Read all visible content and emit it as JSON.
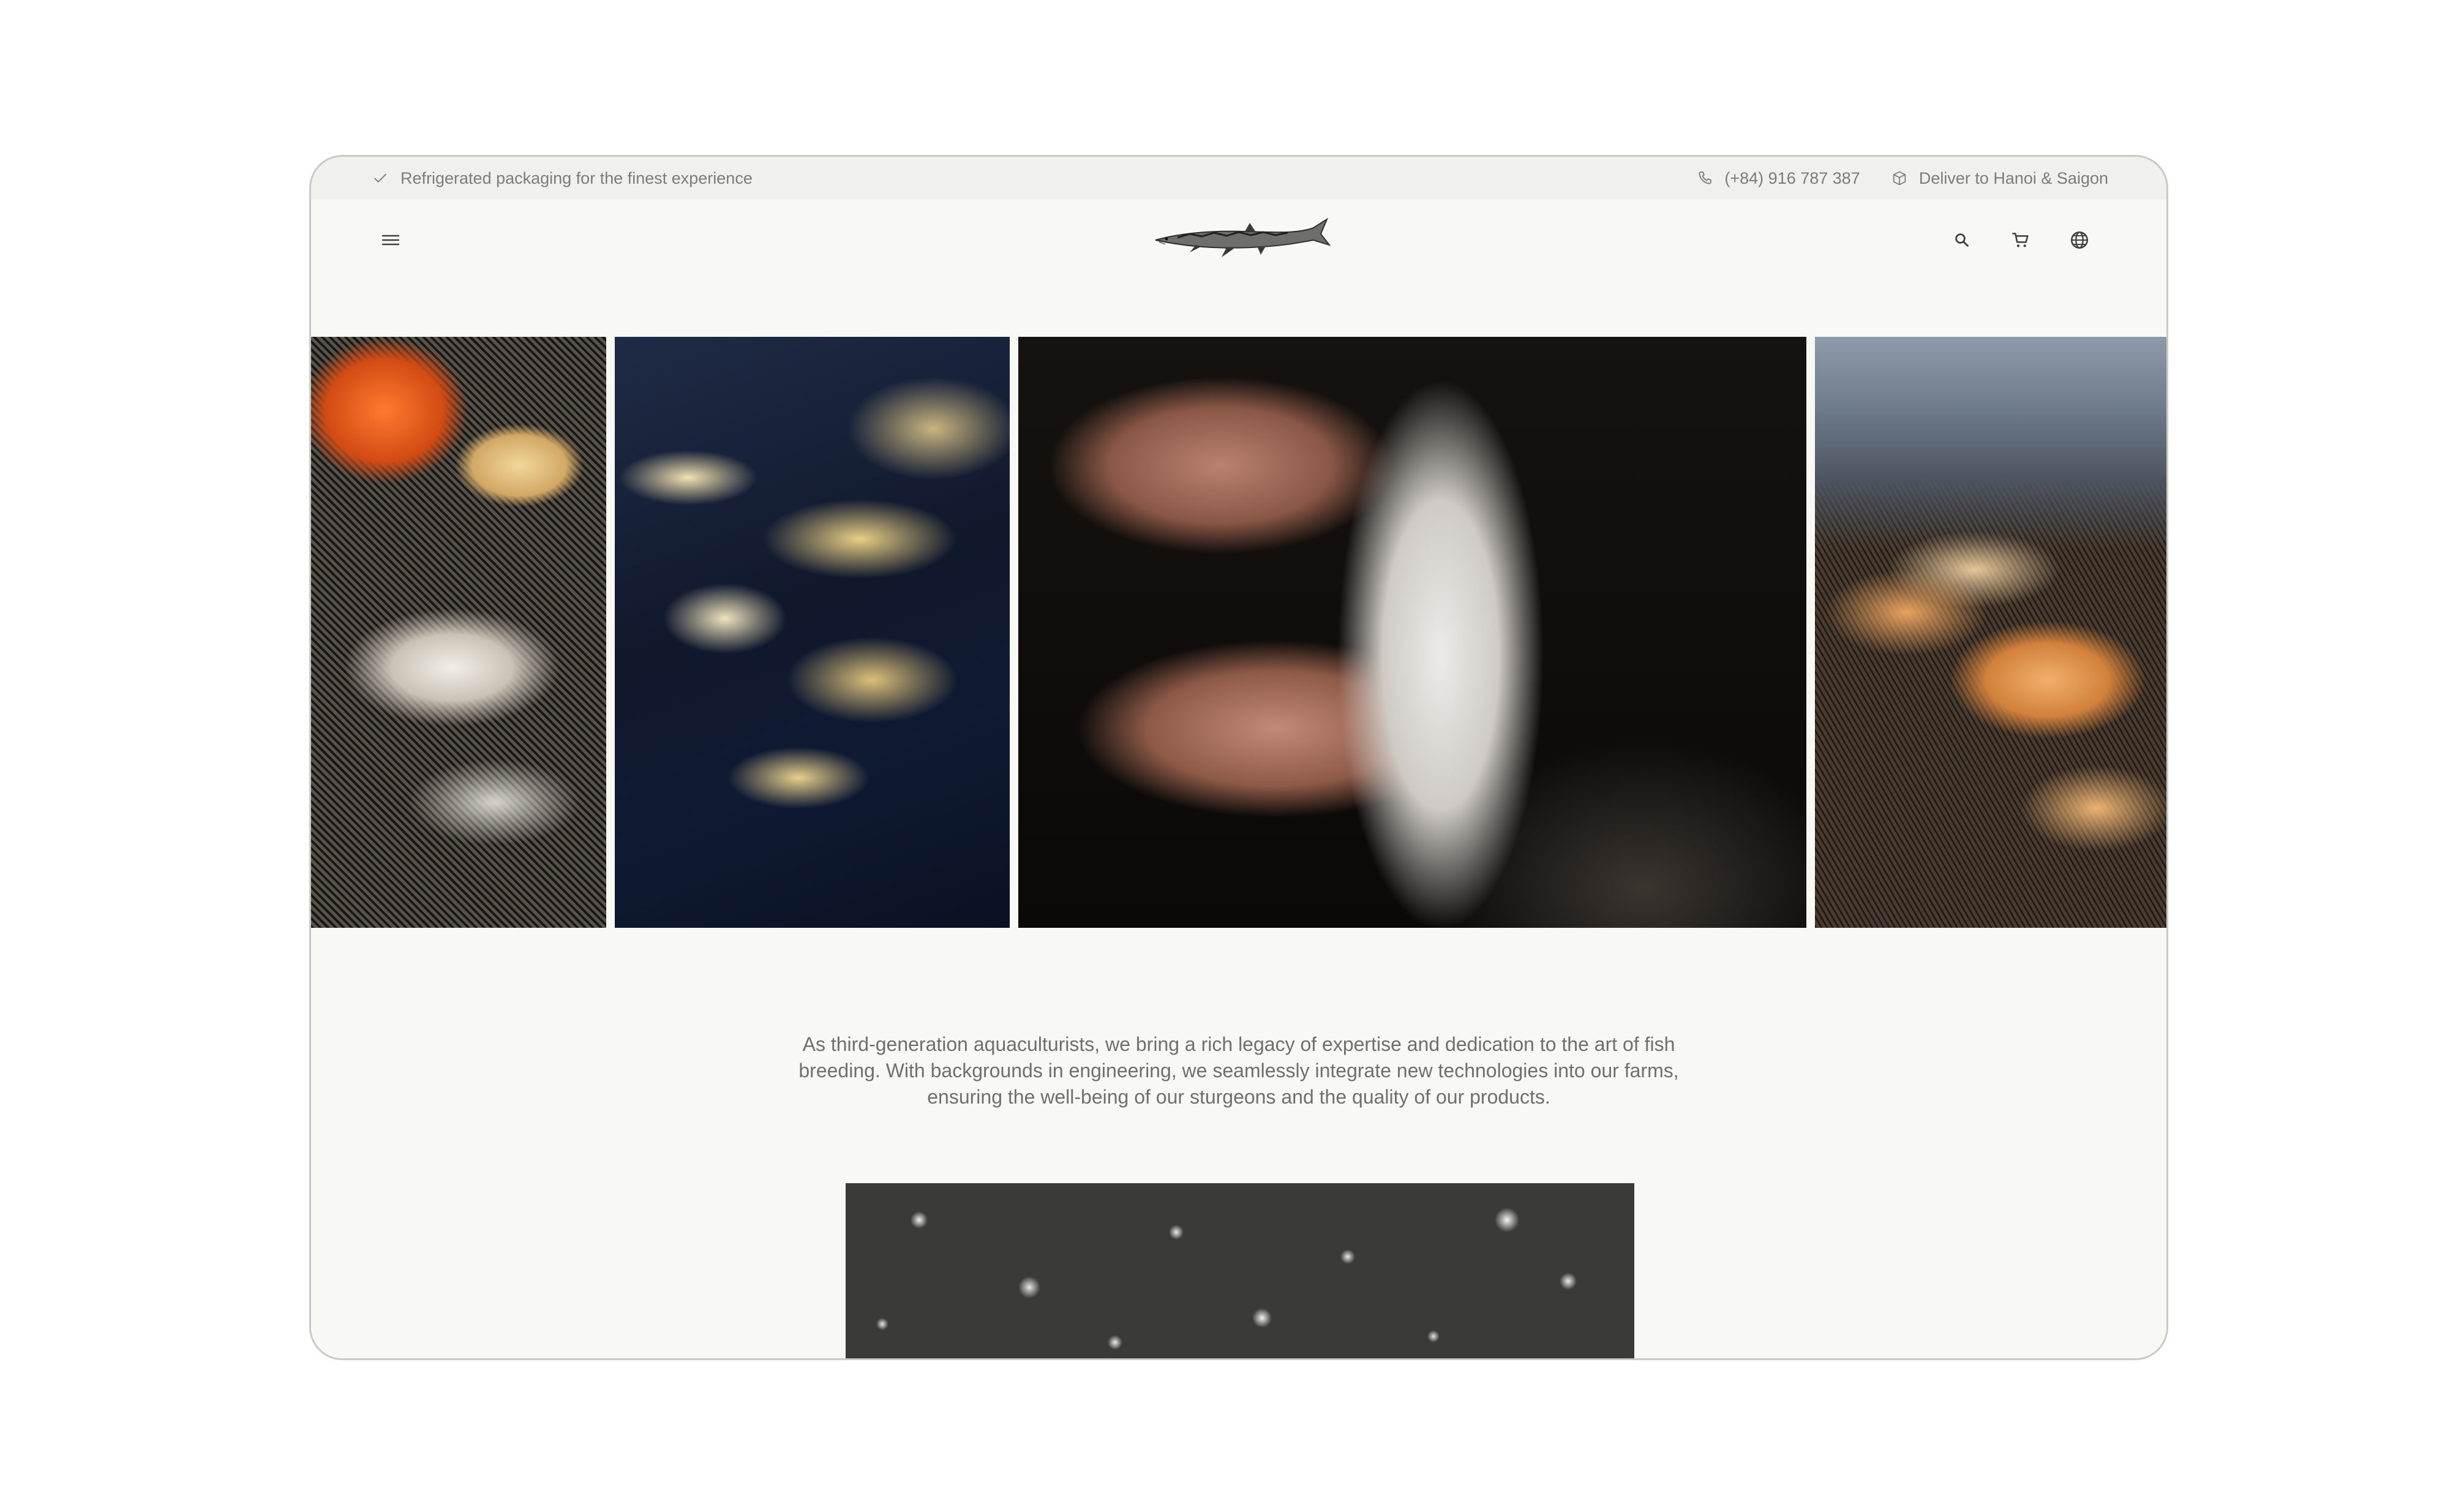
{
  "topbar": {
    "notice": "Refrigerated packaging for the finest experience",
    "phone": "(+84) 916 787 387",
    "delivery": "Deliver to Hanoi & Saigon"
  },
  "header": {
    "menu_icon": "menu-icon",
    "logo_icon": "sturgeon-logo",
    "icons": [
      "search-icon",
      "cart-icon",
      "globe-icon"
    ]
  },
  "gallery": {
    "images": [
      "sturgeon-handling-net-photo",
      "sturgeon-school-water-photo",
      "hands-holding-sturgeon-photo",
      "sturgeon-farm-pond-photo"
    ]
  },
  "intro": {
    "text": "As third-generation aquaculturists, we bring a rich legacy of expertise and dedication to the art of fish breeding. With backgrounds in engineering, we seamlessly integrate new technologies into our farms, ensuring the well-being of our sturgeons and the quality of our products."
  },
  "colors": {
    "page_bg": "#f8f8f4",
    "topbar_bg": "#f0f0ec",
    "text_muted": "#7c7d79",
    "frame_border": "#c9cac5"
  }
}
